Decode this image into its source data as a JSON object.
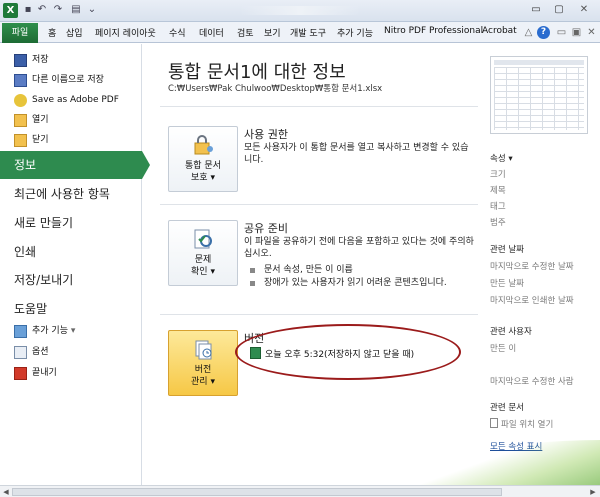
{
  "window": {
    "logo": "X"
  },
  "ribbon": {
    "file_tab": "파일",
    "tabs": [
      "홈",
      "삽입",
      "페이지 레이아웃",
      "수식",
      "데이터",
      "검토",
      "보기",
      "개발 도구",
      "추가 기능",
      "Nitro PDF Professional",
      "Acrobat"
    ]
  },
  "nav": {
    "save": "저장",
    "save_as": "다른 이름으로 저장",
    "save_pdf": "Save as Adobe PDF",
    "open": "열기",
    "close": "닫기",
    "info": "정보",
    "recent": "최근에 사용한 항목",
    "new": "새로 만들기",
    "print": "인쇄",
    "save_send": "저장/보내기",
    "help": "도움말",
    "addins": "추가 기능",
    "options": "옵션",
    "exit": "끝내기"
  },
  "main": {
    "title": "통합 문서1에 대한 정보",
    "path": "C:₩Users₩Pak Chulwoo₩Desktop₩통합 문서1.xlsx",
    "permissions": {
      "button_line1": "통합 문서",
      "button_line2": "보호",
      "title": "사용 권한",
      "desc": "모든 사용자가 이 통합 문서를 열고 복사하고 변경할 수 있습니다."
    },
    "prepare": {
      "button_line1": "문제",
      "button_line2": "확인",
      "title": "공유 준비",
      "desc": "이 파일을 공유하기 전에 다음을 포함하고 있다는 것에 주의하십시오.",
      "bullets": [
        "문서 속성, 만든 이 이름",
        "장애가 있는 사용자가 읽기 어려운 콘텐츠입니다."
      ]
    },
    "versions": {
      "button_line1": "버전",
      "button_line2": "관리",
      "title": "버전",
      "item": "오늘 오후 5:32(저장하지 않고 닫을 때)"
    }
  },
  "right": {
    "properties_header": "속성",
    "props": [
      "크기",
      "제목",
      "태그",
      "범주"
    ],
    "related_dates_header": "관련 날짜",
    "dates": [
      "마지막으로 수정한 날짜",
      "만든 날짜",
      "마지막으로 인쇄한 날짜"
    ],
    "related_people_header": "관련 사용자",
    "author": "만든 이",
    "last_modified_by": "마지막으로 수정한 사람",
    "related_docs_header": "관련 문서",
    "open_location": "파일 위치 열기",
    "show_all": "모든 속성 표시"
  }
}
